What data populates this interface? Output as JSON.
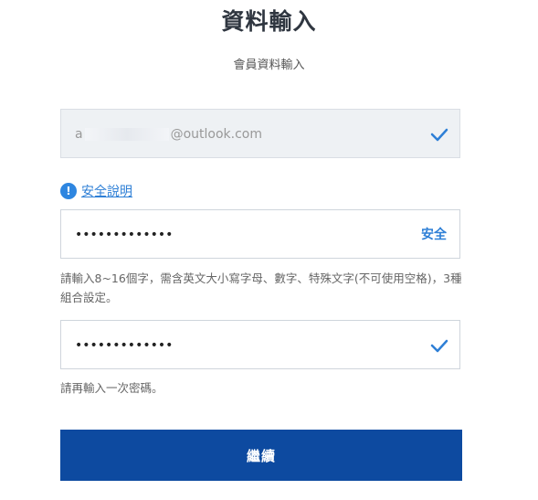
{
  "header": {
    "title": "資料輸入",
    "subtitle": "會員資料輸入"
  },
  "email_field": {
    "prefix": "a",
    "suffix": "@outlook.com",
    "status_icon": "check-icon"
  },
  "security": {
    "info_icon_glyph": "!",
    "link_label": "安全說明"
  },
  "password_field": {
    "value": "•••••••••••••",
    "strength_label": "安全"
  },
  "password_hint": "請輸入8~16個字，需含英文大小寫字母、數字、特殊文字(不可使用空格)，3種組合設定。",
  "confirm_field": {
    "value": "•••••••••••••",
    "status_icon": "check-icon"
  },
  "confirm_hint": "請再輸入一次密碼。",
  "continue_button": {
    "label": "繼續"
  },
  "colors": {
    "accent": "#2e7fd6",
    "button": "#0d4aa0",
    "readonly_bg": "#eef1f4"
  }
}
